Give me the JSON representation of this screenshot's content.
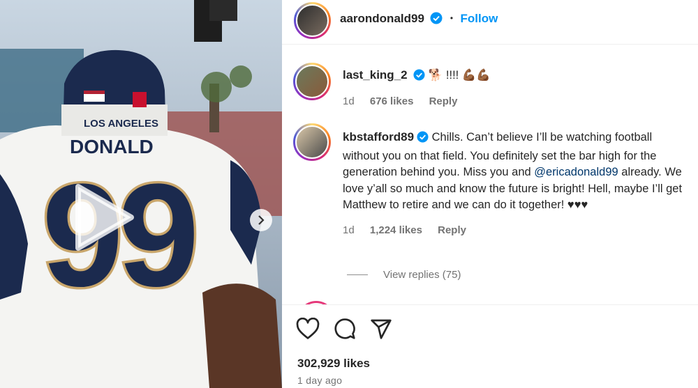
{
  "post": {
    "author": "aarondonald99",
    "separator": "•",
    "follow_label": "Follow",
    "likes": "302,929 likes",
    "time_ago": "1 day ago"
  },
  "media": {
    "helmet_text": "LOS ANGELES",
    "jersey_name": "DONALD",
    "jersey_number": "99",
    "colors": {
      "navy": "#1b2a4e",
      "gold": "#c9a66b",
      "white": "#f4f4f2"
    }
  },
  "comments": [
    {
      "username": "last_king_2",
      "text": "🐕 !!!! 💪🏾💪🏾",
      "time": "1d",
      "likes": "676 likes",
      "reply_label": "Reply"
    },
    {
      "username": "kbstafford89",
      "text_before_mention": "Chills. Can’t believe I’ll be watching football without you on that field. You definitely set the bar high for the generation behind you. Miss you and ",
      "mention": "@ericadonald99",
      "text_after_mention": " already. We love y’all so much and know the future is bright! Hell, maybe I’ll get Matthew to retire and we can do it together! ♥♥♥",
      "time": "1d",
      "likes": "1,224 likes",
      "reply_label": "Reply",
      "view_replies": "View replies (75)"
    }
  ],
  "icons": {
    "like": "heart-icon",
    "comment": "comment-icon",
    "share": "share-icon",
    "play": "play-icon",
    "next": "chevron-right-icon",
    "verified": "verified-badge-icon"
  },
  "accent_color": "#0095f6"
}
